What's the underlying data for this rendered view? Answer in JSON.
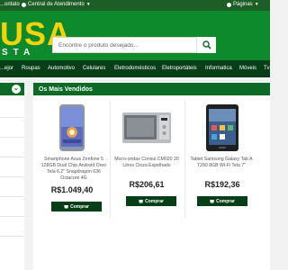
{
  "topbar": {
    "item1": "...ontato",
    "item2": "Central de Atendimento",
    "item3": "Páginas"
  },
  "logo": {
    "main": "USA",
    "sub": "STA"
  },
  "search": {
    "placeholder": "Encontre o produto desejado..."
  },
  "nav": {
    "items": [
      "...ejor",
      "Roupas",
      "Automotivo",
      "Celulares",
      "Eletrodomésticos",
      "Eletroportáteis",
      "Informatica",
      "Móveis",
      "Tv"
    ]
  },
  "section": {
    "title": "Os Mais Vendidos"
  },
  "products": [
    {
      "title": "Smartphone Asus Zenfone 5 128GB Dual Chip Android Oreo Tela 6.2\" Snapdragon 636 Octacore 4G",
      "price": "R$1.049,40",
      "buy_label": "Comprar"
    },
    {
      "title": "Micro-ondas Consul CM020 20 Litros Cinza Espelhado",
      "price": "R$206,61",
      "buy_label": "Comprar"
    },
    {
      "title": "Tablet Samsung Galaxy Tab A T280 8GB Wi-Fi Tela 7\"",
      "price": "R$192,36",
      "buy_label": "Comprar"
    }
  ],
  "colors": {
    "topbar": "#1d5e27",
    "header": "#0d8a2b",
    "nav": "#063f17",
    "logo": "#f5d20a",
    "section_head": "#0b6a25"
  }
}
